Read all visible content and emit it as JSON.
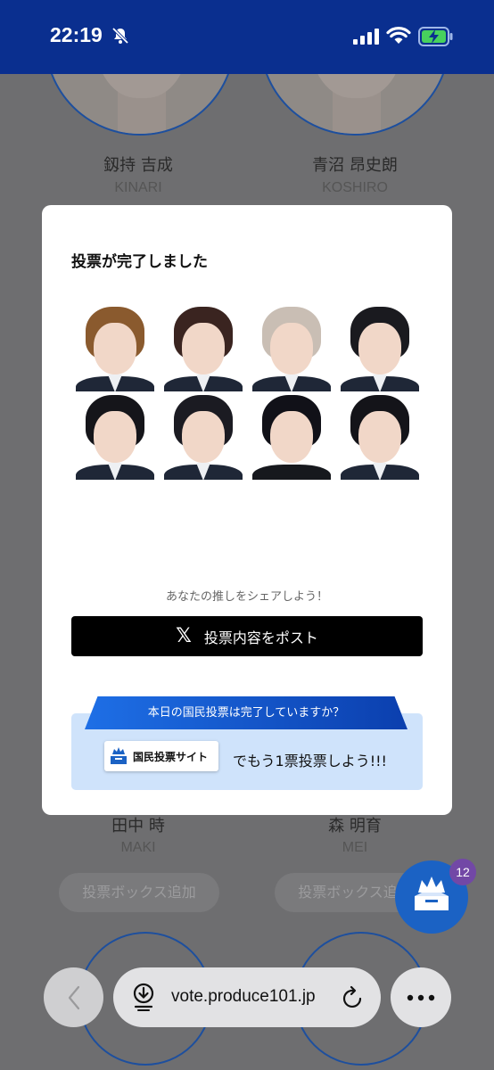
{
  "status": {
    "time": "22:19",
    "icons": [
      "bell-muted-icon",
      "signal-icon",
      "wifi-icon",
      "battery-charging-icon"
    ]
  },
  "background": {
    "top_cards": [
      {
        "name": "釼持 吉成",
        "roman": "KINARI"
      },
      {
        "name": "青沼 昂史朗",
        "roman": "KOSHIRO"
      }
    ],
    "bottom_cards": [
      {
        "name": "田中 時",
        "roman": "MAKI",
        "button": "投票ボックス追加"
      },
      {
        "name": "森 明育",
        "roman": "MEI",
        "button": "投票ボックス追加"
      }
    ],
    "fab_badge": "12"
  },
  "modal": {
    "title": "投票が完了しました",
    "share_text": "あなたの推しをシェアしよう！",
    "post_button": "投票内容をポスト",
    "ribbon_text": "本日の国民投票は完了していますか？",
    "site_button": "国民投票サイト",
    "cta_text": "でもう1票投票しよう!!!"
  },
  "browser": {
    "url": "vote.produce101.jp"
  }
}
